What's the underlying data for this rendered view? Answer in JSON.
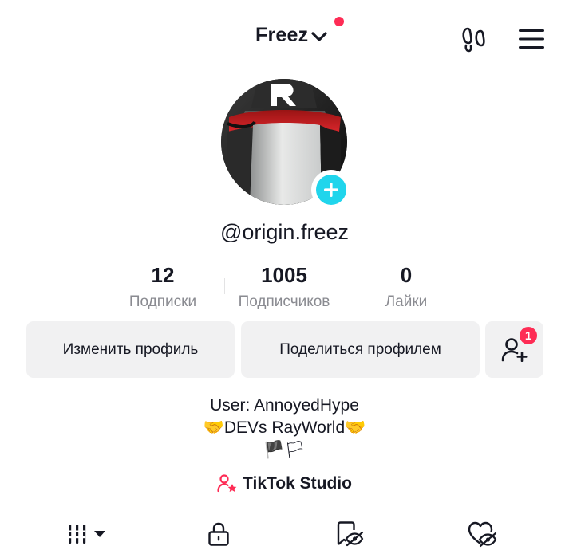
{
  "header": {
    "account_name": "Freez",
    "icons": [
      "chevron-down-icon",
      "footprints-icon",
      "hamburger-menu-icon"
    ]
  },
  "profile": {
    "username": "@origin.freez",
    "stats": [
      {
        "value": "12",
        "label": "Подписки"
      },
      {
        "value": "1005",
        "label": "Подписчиков"
      },
      {
        "value": "0",
        "label": "Лайки"
      }
    ]
  },
  "actions": {
    "edit_profile": "Изменить профиль",
    "share_profile": "Поделиться профилем",
    "friends_badge_count": "1"
  },
  "bio": {
    "line1": "User: AnnoyedHype",
    "line2": "🤝DEVs RayWorld🤝",
    "line3": "🏴🏳"
  },
  "studio": {
    "label": "TikTok Studio"
  },
  "tabs": [
    "videos-grid-icon",
    "private-lock-icon",
    "reposts-hidden-icon",
    "liked-hidden-icon"
  ],
  "colors": {
    "accent_red": "#fe2c55",
    "add_button": "#20d5ec",
    "button_bg": "#f1f1f2",
    "muted_text": "#8a8b91"
  }
}
